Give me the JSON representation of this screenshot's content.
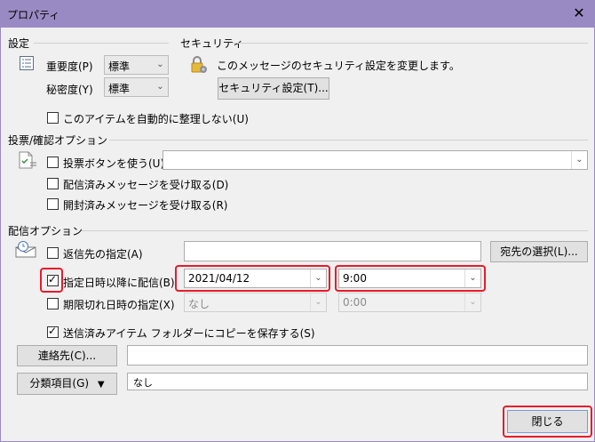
{
  "window": {
    "title": "プロパティ",
    "close_glyph": "✕"
  },
  "settings": {
    "section_title": "設定",
    "importance": {
      "label": "重要度(P)",
      "value": "標準"
    },
    "sensitivity": {
      "label": "秘密度(Y)",
      "value": "標準"
    },
    "auto_archive": {
      "label": "このアイテムを自動的に整理しない(U)",
      "checked": false
    }
  },
  "security": {
    "section_title": "セキュリティ",
    "text": "このメッセージのセキュリティ設定を変更します。",
    "button_label": "セキュリティ設定(T)..."
  },
  "voting": {
    "section_title": "投票/確認オプション",
    "use_voting_buttons": {
      "label": "投票ボタンを使う(U)",
      "checked": false
    },
    "voting_value": "",
    "delivery_receipt": {
      "label": "配信済みメッセージを受け取る(D)",
      "checked": false
    },
    "read_receipt": {
      "label": "開封済みメッセージを受け取る(R)",
      "checked": false
    }
  },
  "delivery": {
    "section_title": "配信オプション",
    "reply_to": {
      "label": "返信先の指定(A)",
      "checked": false,
      "value": ""
    },
    "select_names_button": "宛先の選択(L)...",
    "defer_delivery": {
      "label": "指定日時以降に配信(B)",
      "checked": true,
      "date": "2021/04/12",
      "time": "9:00"
    },
    "expires": {
      "label": "期限切れ日時の指定(X)",
      "checked": false,
      "date": "なし",
      "time": "0:00"
    },
    "save_copy": {
      "label": "送信済みアイテム フォルダーにコピーを保存する(S)",
      "checked": true
    }
  },
  "contacts": {
    "button_label": "連絡先(C)...",
    "value": ""
  },
  "categories": {
    "button_label": "分類項目(G)",
    "button_mnemonic": "G",
    "value": "なし"
  },
  "footer": {
    "close_label": "閉じる"
  },
  "colors": {
    "titlebar": "#9a8ac4",
    "highlight": "#e81b2a",
    "background": "#f0f0f0"
  }
}
